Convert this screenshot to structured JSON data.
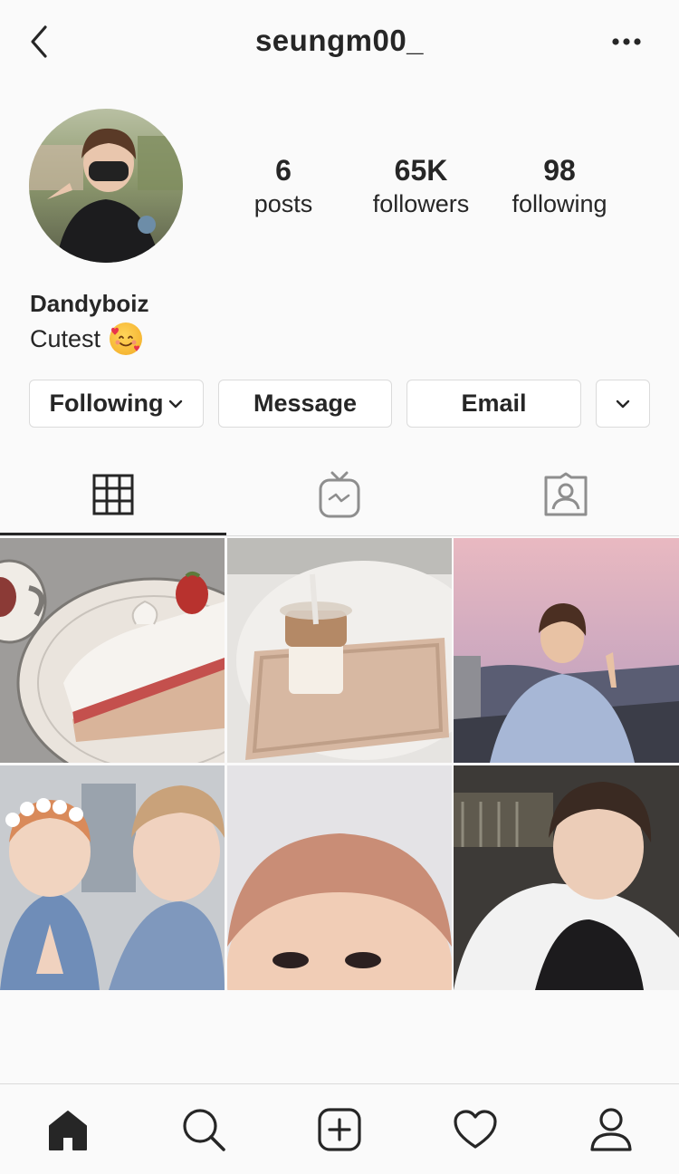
{
  "header": {
    "title": "seungm00_",
    "back_icon": "chevron-left-icon",
    "more_icon": "more-horizontal-icon"
  },
  "profile": {
    "stats": [
      {
        "value": "6",
        "label": "posts"
      },
      {
        "value": "65K",
        "label": "followers"
      },
      {
        "value": "98",
        "label": "following"
      }
    ],
    "name": "Dandyboiz",
    "bio": "Cutest",
    "bio_emoji": "smiling-face-with-hearts-emoji"
  },
  "actions": {
    "following_label": "Following",
    "message_label": "Message",
    "email_label": "Email"
  },
  "tabs": [
    {
      "icon": "grid-icon",
      "active": true
    },
    {
      "icon": "igtv-icon",
      "active": false
    },
    {
      "icon": "tagged-icon",
      "active": false
    }
  ],
  "posts": [
    {
      "description": "cake illustration"
    },
    {
      "description": "iced coffee on tray"
    },
    {
      "description": "peace sign at sunset"
    },
    {
      "description": "flower crown selfie"
    },
    {
      "description": "close-up selfie"
    },
    {
      "description": "night selfie"
    }
  ],
  "bottom_nav": [
    {
      "icon": "home-icon",
      "active": true
    },
    {
      "icon": "search-icon",
      "active": false
    },
    {
      "icon": "add-post-icon",
      "active": false
    },
    {
      "icon": "heart-icon",
      "active": false
    },
    {
      "icon": "profile-icon",
      "active": false
    }
  ],
  "colors": {
    "background": "#fafafa",
    "text": "#262626",
    "border": "#dbdbdb"
  }
}
